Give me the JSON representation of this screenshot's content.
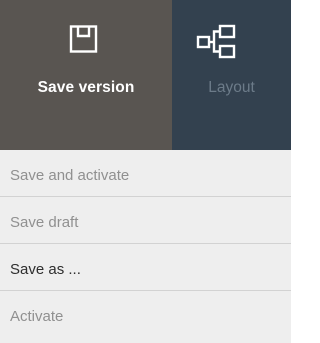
{
  "toolbar": {
    "save_version": {
      "label": "Save version",
      "icon": "floppy-save-icon",
      "background": "#595551",
      "color": "#ffffff"
    },
    "layout": {
      "label": "Layout",
      "icon": "layout-tree-icon",
      "background": "#33414f",
      "color": "#6c7b89"
    }
  },
  "menu": {
    "background": "#eeeeee",
    "items": [
      {
        "label": "Save and activate",
        "enabled": false
      },
      {
        "label": "Save draft",
        "enabled": false
      },
      {
        "label": "Save as ...",
        "enabled": true
      },
      {
        "label": "Activate",
        "enabled": false
      }
    ]
  }
}
